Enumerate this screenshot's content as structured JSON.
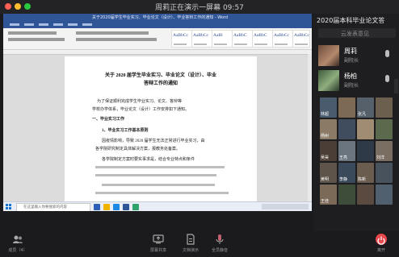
{
  "window": {
    "title": "周莉正在演示一屏幕 09:57"
  },
  "word": {
    "title_bar": "关于2020届学生毕业实习、毕业论文（设计）、毕业答辩工作的通知 - Word",
    "styles": [
      "AaBbCc",
      "AaBbCc",
      "AaBl",
      "AaBbC",
      "AaBbC",
      "AaBbCc",
      "AaBbCc"
    ]
  },
  "document": {
    "heading_line1": "关于 2020 届学生毕业实习、毕业论文（设计）、毕业",
    "heading_line2": "答辩工作的通知",
    "para1_line1": "为了保证顺利完成学生毕业实习、论文、答辩等",
    "para1_line2": "学校办学体系，毕业论文（设计）工作安排如下通知。",
    "section1": "一、毕业实习工作",
    "subsection1": "1、毕业实习工作基本原则",
    "para2_line1": "因疫情影响，导致 2020 届学生无法正常进行毕业实习，由",
    "para2_line2": "各学院研究制定具体解决方案，报教务处备案。",
    "para3_line1": "各学院制定方案时要实事求是，结合专业特点和条件",
    "taskbar_search": "在这里输入你要搜索的内容"
  },
  "sidebar": {
    "meeting_title": "2020届本科毕业论文答",
    "subtitle": "云发表意见",
    "speakers": [
      {
        "name": "周莉",
        "role": "副院长"
      },
      {
        "name": "杨柏",
        "role": "副院长"
      }
    ],
    "tiles": [
      {
        "label": "林超"
      },
      {
        "label": ""
      },
      {
        "label": "张凡"
      },
      {
        "label": ""
      },
      {
        "label": "杨树"
      },
      {
        "label": ""
      },
      {
        "label": ""
      },
      {
        "label": ""
      },
      {
        "label": "吴昊"
      },
      {
        "label": "王亮"
      },
      {
        "label": ""
      },
      {
        "label": "刘洋"
      },
      {
        "label": "黄明"
      },
      {
        "label": "李静"
      },
      {
        "label": "陈新"
      },
      {
        "label": ""
      },
      {
        "label": "王佳"
      },
      {
        "label": ""
      },
      {
        "label": ""
      },
      {
        "label": ""
      }
    ]
  },
  "toolbar": {
    "members": "成员（4）",
    "share_screen": "屏幕共享",
    "doc_collab": "文档演示",
    "mute_all": "全员静音",
    "leave": "离开"
  },
  "colors": {
    "word_blue": "#2f5597",
    "leave_red": "#e5484d",
    "background": "#1b1b1d"
  }
}
